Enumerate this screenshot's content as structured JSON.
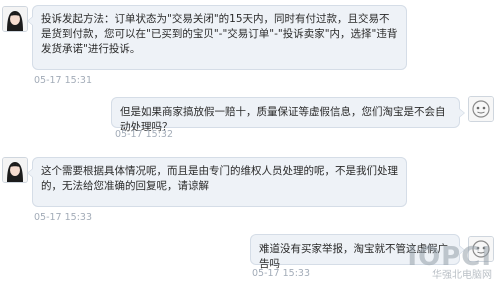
{
  "messages": [
    {
      "side": "left",
      "text": "投诉发起方法：订单状态为\"交易关闭\"的15天内，同时有付过款，且交易不是货到付款，您可以在\"已买到的宝贝\"-\"交易订单\"-\"投诉卖家\"内，选择\"违背发货承诺\"进行投诉。",
      "time": "05-17 15:31",
      "avatar": "female-avatar-icon"
    },
    {
      "side": "right",
      "text": "但是如果商家搞放假一赔十，质量保证等虚假信息，您们淘宝是不会自动处理吗？",
      "time": "05-17 15:32",
      "avatar": "user-avatar-icon"
    },
    {
      "side": "left",
      "text": "这个需要根据具体情况呢，而且是由专门的维权人员处理的呢，不是我们处理的，无法给您准确的回复呢，请谅解",
      "time": "05-17 15:33",
      "avatar": "female-avatar-icon"
    },
    {
      "side": "right",
      "text": "难道没有买家举报，淘宝就不管这虚假广告吗",
      "time": "05-17 15:33",
      "avatar": "user-avatar-icon"
    }
  ],
  "watermark": {
    "logo": "IOPCI",
    "site": "华强北电脑网"
  }
}
